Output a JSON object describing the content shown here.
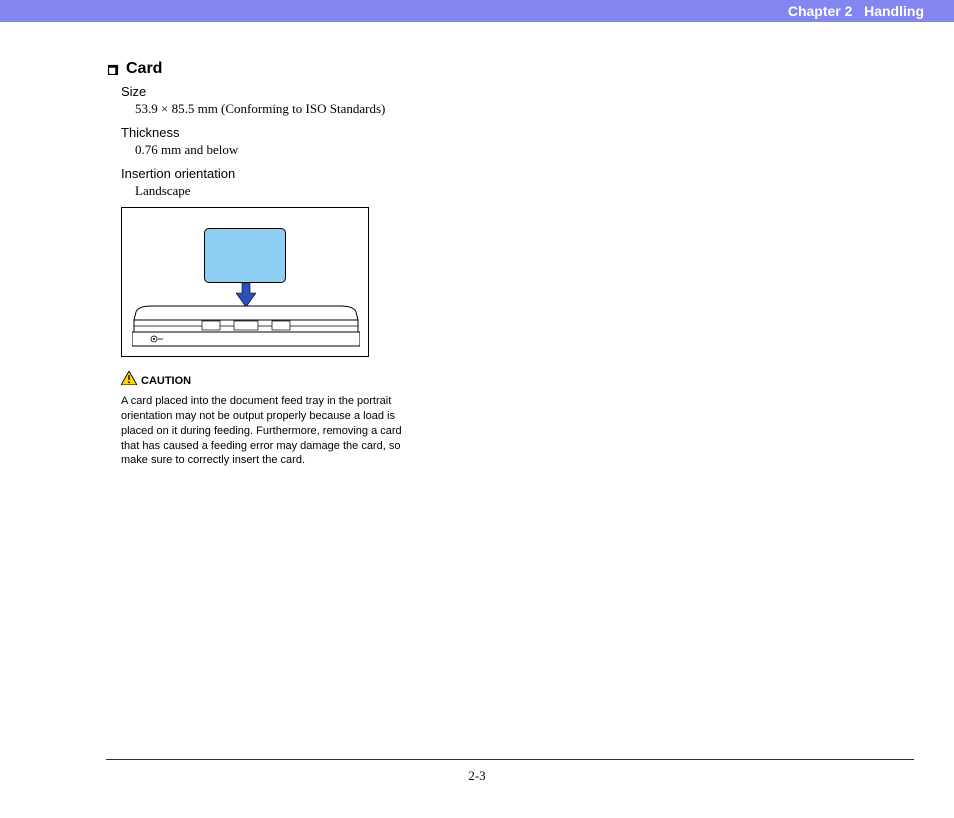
{
  "header": {
    "chapter": "Chapter 2",
    "title": "Handling"
  },
  "section": {
    "title": "Card",
    "specs": {
      "size_label": "Size",
      "size_value": "53.9 × 85.5 mm (Conforming to ISO Standards)",
      "thickness_label": "Thickness",
      "thickness_value": "0.76 mm and below",
      "orientation_label": "Insertion orientation",
      "orientation_value": "Landscape"
    }
  },
  "caution": {
    "label": "CAUTION",
    "text": "A card placed into the document feed tray in the portrait orientation may not be output properly because a load is placed on it during feeding. Furthermore, removing a card that has caused a feeding error may damage the card, so make sure to correctly insert the card."
  },
  "footer": {
    "page": "2-3"
  }
}
